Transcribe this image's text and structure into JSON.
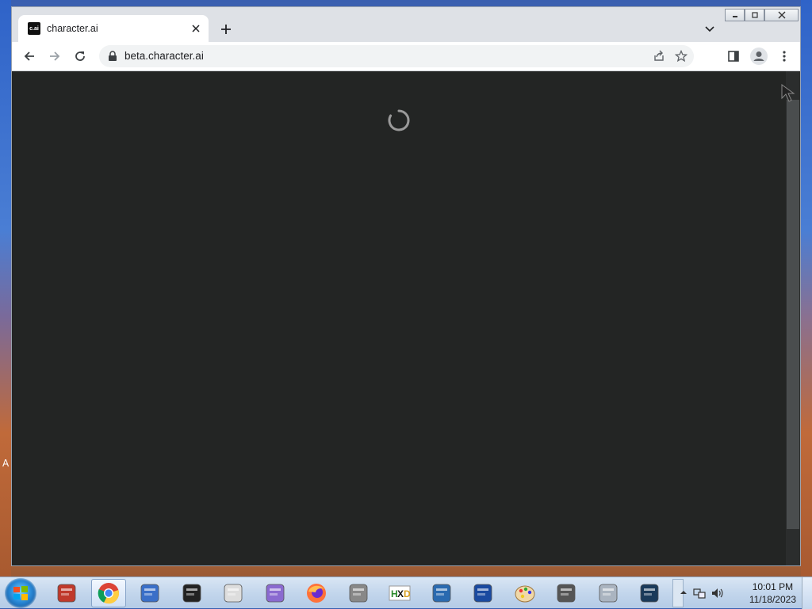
{
  "browser": {
    "tab": {
      "favicon_text": "c.ai",
      "title": "character.ai"
    },
    "address_bar": {
      "url": "beta.character.ai"
    }
  },
  "desktop": {
    "edge_label": "A"
  },
  "taskbar": {
    "apps": [
      {
        "name": "file-manager-icon",
        "color": "#c0392b"
      },
      {
        "name": "chrome-icon",
        "color": "#4285f4"
      },
      {
        "name": "settings-app-icon",
        "color": "#3a6fc8"
      },
      {
        "name": "magic-hat-icon",
        "color": "#222222"
      },
      {
        "name": "solitaire-icon",
        "color": "#dddddd"
      },
      {
        "name": "notes-app-icon",
        "color": "#8a6ad0"
      },
      {
        "name": "firefox-icon",
        "color": "#ff7139"
      },
      {
        "name": "script-app-icon",
        "color": "#888888"
      },
      {
        "name": "hxd-icon",
        "color": "#2a8a2a"
      },
      {
        "name": "remote-desktop-icon",
        "color": "#2a6ab0"
      },
      {
        "name": "network-app-icon",
        "color": "#1a4aa0"
      },
      {
        "name": "paint-icon",
        "color": "#e0a040"
      },
      {
        "name": "photos-icon",
        "color": "#555555"
      },
      {
        "name": "document-app-icon",
        "color": "#aab4c0"
      },
      {
        "name": "phone-app-icon",
        "color": "#1a3a5a"
      }
    ],
    "clock": {
      "time": "10:01 PM",
      "date": "11/18/2023"
    }
  }
}
